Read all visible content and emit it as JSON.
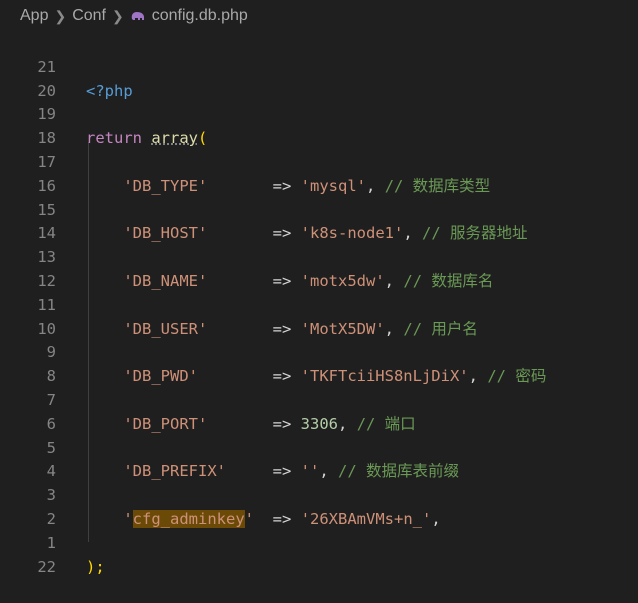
{
  "breadcrumb": {
    "folder1": "App",
    "folder2": "Conf",
    "file": "config.db.php"
  },
  "colors": {
    "bg": "#1f1f1f",
    "string": "#ce9178",
    "comment": "#6a9955",
    "keyword": "#c586c0",
    "number": "#b5cea8"
  },
  "lines": [
    {
      "n": "21",
      "open": "<?php"
    },
    {
      "n": "20"
    },
    {
      "n": "19",
      "kw": "return",
      "fn": "array",
      "paren": "("
    },
    {
      "n": "18"
    },
    {
      "n": "17",
      "key": "'DB_TYPE'",
      "pad": "       ",
      "arrow": "=>",
      "val": "'mysql'",
      "comma": ",",
      "cmt": "// 数据库类型"
    },
    {
      "n": "16"
    },
    {
      "n": "15",
      "key": "'DB_HOST'",
      "pad": "       ",
      "arrow": "=>",
      "val": "'k8s-node1'",
      "comma": ",",
      "cmt": "// 服务器地址"
    },
    {
      "n": "14"
    },
    {
      "n": "13",
      "key": "'DB_NAME'",
      "pad": "       ",
      "arrow": "=>",
      "val": "'motx5dw'",
      "comma": ",",
      "cmt": "// 数据库名"
    },
    {
      "n": "12"
    },
    {
      "n": "11",
      "key": "'DB_USER'",
      "pad": "       ",
      "arrow": "=>",
      "val": "'MotX5DW'",
      "comma": ",",
      "cmt": "// 用户名"
    },
    {
      "n": "10"
    },
    {
      "n": "9",
      "key": "'DB_PWD'",
      "pad": "        ",
      "arrow": "=>",
      "val": "'TKFTciiHS8nLjDiX'",
      "comma": ",",
      "cmt": "// 密码"
    },
    {
      "n": "8"
    },
    {
      "n": "7",
      "key": "'DB_PORT'",
      "pad": "       ",
      "arrow": "=>",
      "num": "3306",
      "comma": ",",
      "cmt": "// 端口"
    },
    {
      "n": "6"
    },
    {
      "n": "5",
      "key": "'DB_PREFIX'",
      "pad": "     ",
      "arrow": "=>",
      "val": "''",
      "comma": ",",
      "cmt": "// 数据库表前缀"
    },
    {
      "n": "4"
    },
    {
      "n": "3",
      "q1": "'",
      "hlkey": "cfg_adminkey",
      "q2": "'",
      "pad": "  ",
      "arrow": "=>",
      "val": "'26XBAmVMs+n_'",
      "comma": ","
    },
    {
      "n": "2"
    },
    {
      "n": "1",
      "close": ");"
    },
    {
      "n": "22"
    }
  ]
}
